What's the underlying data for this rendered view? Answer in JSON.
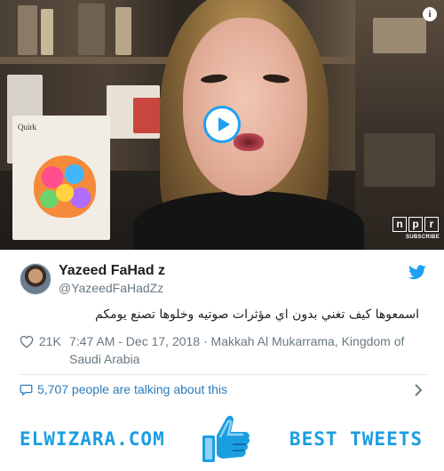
{
  "video": {
    "poster_text": "Quirk",
    "npr_letters": [
      "n",
      "p",
      "r"
    ],
    "npr_subscribe": "SUBSCRIBE",
    "info_label": "i"
  },
  "tweet": {
    "display_name": "Yazeed FaHad z",
    "handle": "@YazeedFaHadZz",
    "text": "اسمعوها كيف تغني بدون اي مؤثرات صوتيه وخلوها تصنع يومكم",
    "likes": "21K",
    "meta": "7:47 AM - Dec 17, 2018 · Makkah Al Mukarrama, Kingdom of Saudi Arabia",
    "talking": "5,707 people are talking about this"
  },
  "footer": {
    "brand_left": "ELWIZARA.COM",
    "brand_right": "BEST TWEETS"
  },
  "colors": {
    "accent": "#1da1f2",
    "link": "#2b7bb9",
    "brand": "#1b9ee0",
    "muted": "#697882"
  },
  "icons": [
    "info-icon",
    "play-icon",
    "twitter-bird-icon",
    "heart-icon",
    "comment-icon",
    "chevron-right-icon",
    "thumbs-up-icon"
  ]
}
